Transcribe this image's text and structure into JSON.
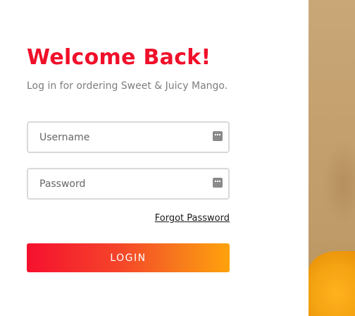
{
  "header": {
    "title": "Welcome Back!",
    "subtitle": "Log in for ordering Sweet & Juicy Mango."
  },
  "form": {
    "username": {
      "placeholder": "Username",
      "value": "",
      "icon": "key-icon"
    },
    "password": {
      "placeholder": "Password",
      "value": "",
      "icon": "key-icon"
    },
    "forgot_label": "Forgot Password",
    "login_label": "LOGIN"
  },
  "colors": {
    "accent": "#f0102a",
    "button_gradient_start": "#f5102e",
    "button_gradient_end": "#ffa20c"
  }
}
